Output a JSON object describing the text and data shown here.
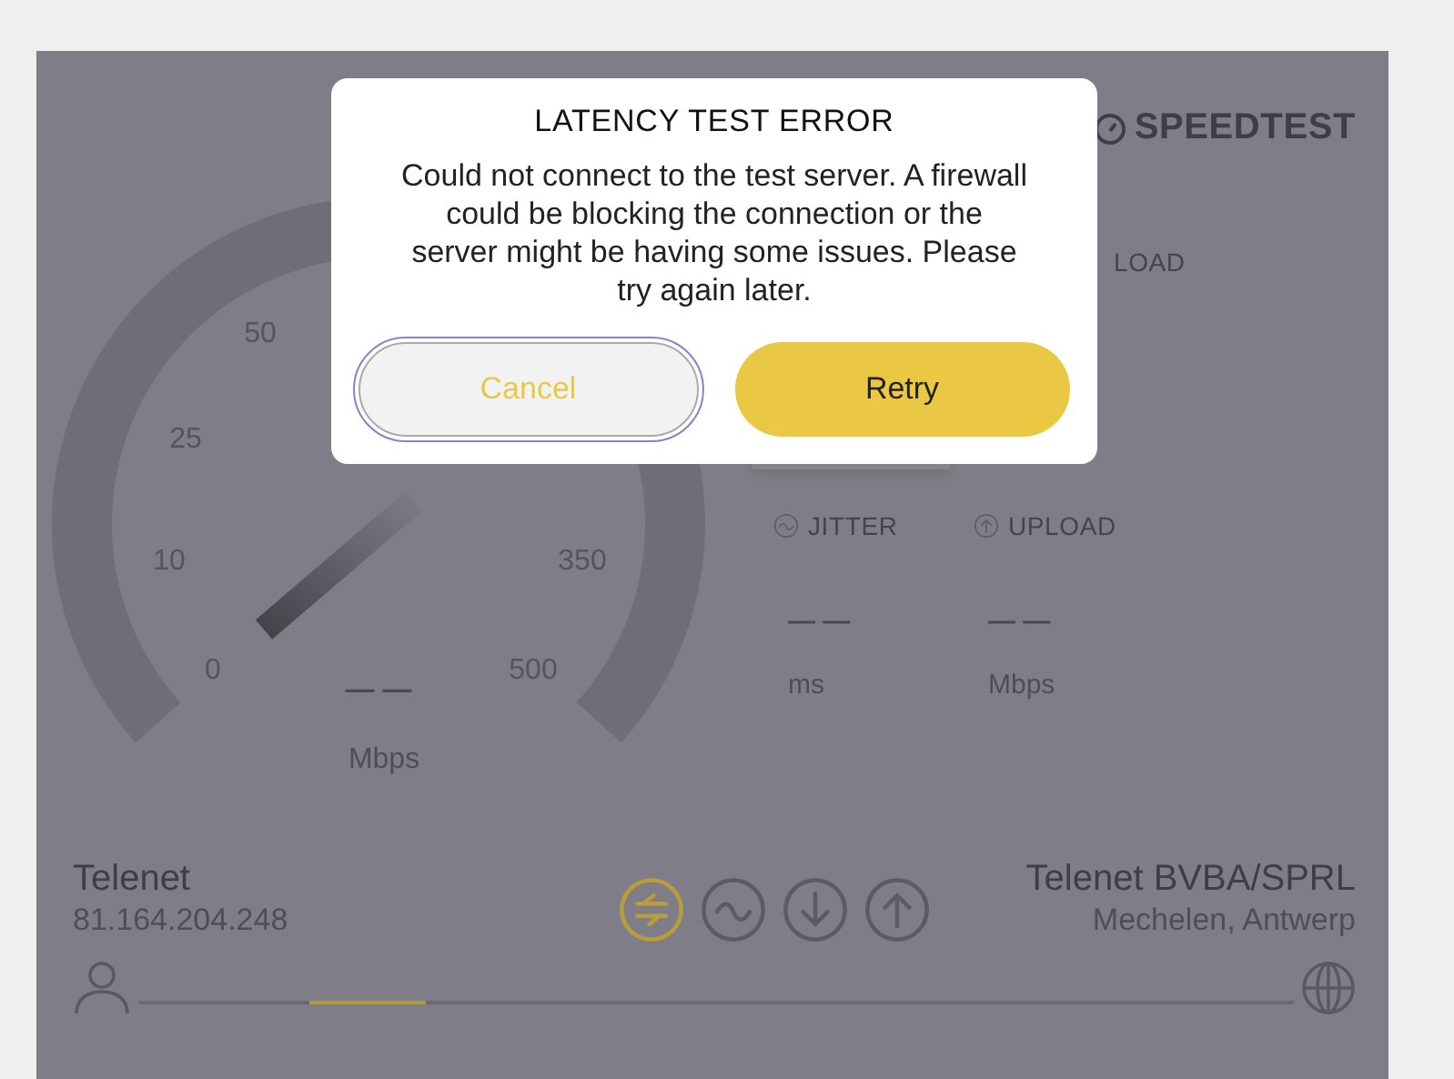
{
  "dialog": {
    "title": "LATENCY TEST ERROR",
    "message": "Could not connect to the test server. A firewall could be blocking the connection or the server might be having some issues. Please try again later.",
    "buttons": [
      {
        "label": "Cancel",
        "kind": "secondary",
        "focused": true
      },
      {
        "label": "Retry",
        "kind": "primary",
        "focused": false
      }
    ]
  },
  "logo": {
    "text": "SPEEDTEST"
  },
  "download_label": "LOAD",
  "gauge": {
    "ticks": [
      "50",
      "25",
      "10",
      "0",
      "350",
      "500"
    ],
    "reading": "— —",
    "unit": "Mbps"
  },
  "metrics": [
    {
      "kind": "jitter",
      "label": "JITTER",
      "reading": "— —",
      "unit": "ms"
    },
    {
      "kind": "upload",
      "label": "UPLOAD",
      "reading": "— —",
      "unit": "Mbps"
    }
  ],
  "isp": {
    "name": "Telenet",
    "ip": "81.164.204.248"
  },
  "steps": [
    {
      "kind": "ping",
      "selected": true
    },
    {
      "kind": "jitter",
      "selected": false
    },
    {
      "kind": "download",
      "selected": false
    },
    {
      "kind": "upload",
      "selected": false
    }
  ],
  "server": {
    "name": "Telenet BVBA/SPRL",
    "location": "Mechelen, Antwerp"
  }
}
